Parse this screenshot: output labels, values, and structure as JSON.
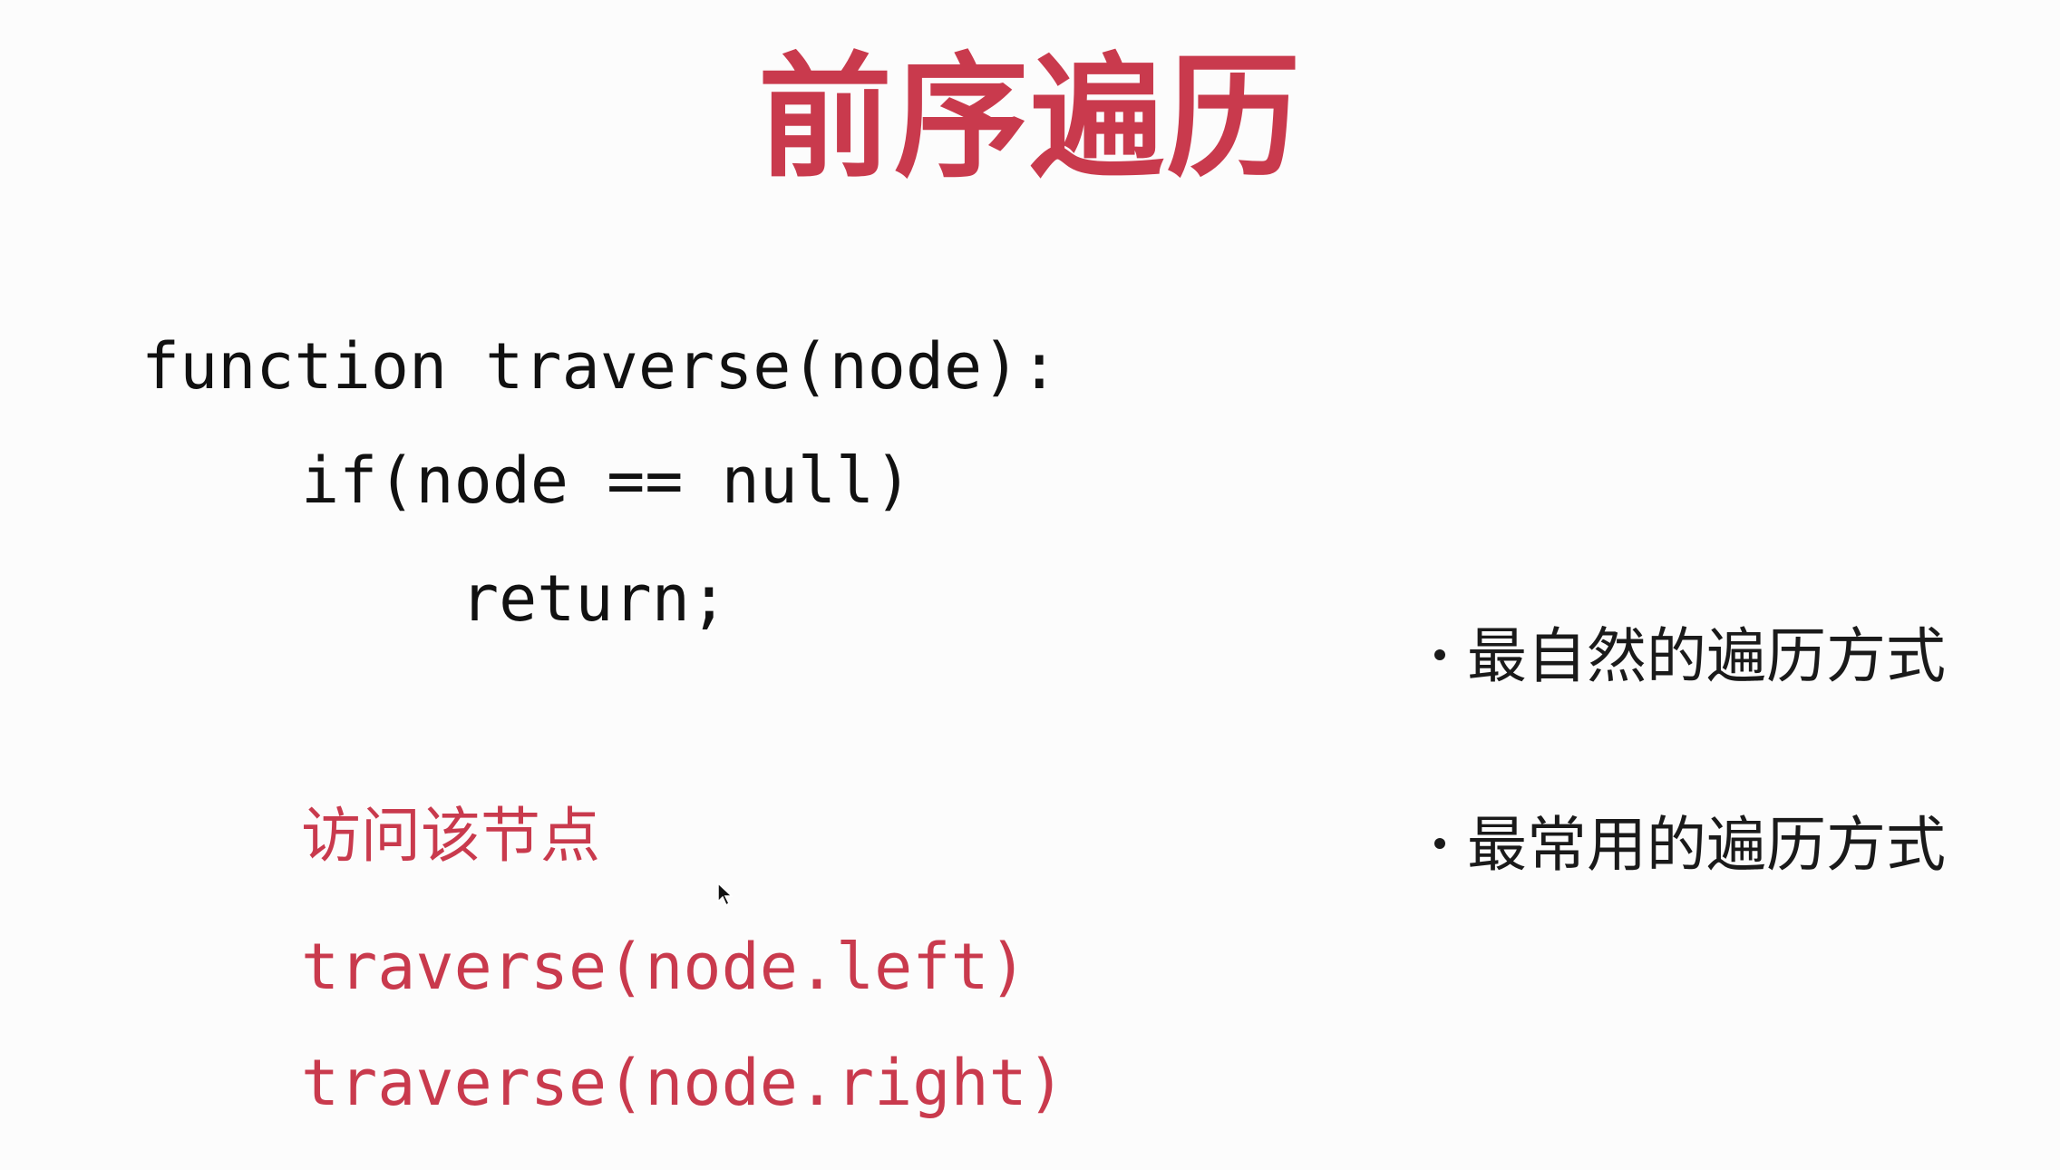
{
  "slide": {
    "title": "前序遍历",
    "code": {
      "line1": "function traverse(node):",
      "line2": "if(node == null)",
      "line3": "return;",
      "visit": "访问该节点",
      "left_call": "traverse(node.left)",
      "right_call": "traverse(node.right)"
    },
    "bullets": [
      "最自然的遍历方式",
      "最常用的遍历方式"
    ]
  },
  "colors": {
    "accent": "#c93a4d",
    "text": "#111111",
    "background": "#fcfcfc"
  },
  "icons": {
    "cursor": "mouse-pointer-icon"
  }
}
